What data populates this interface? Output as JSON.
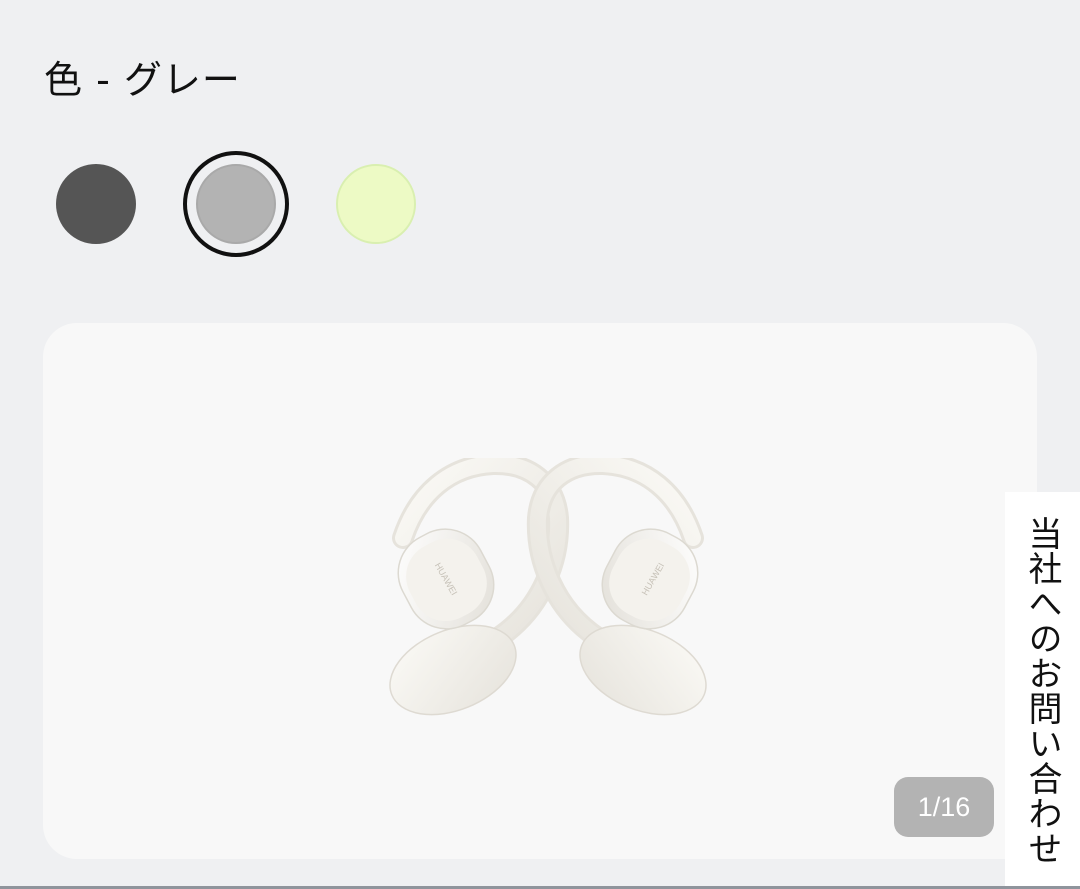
{
  "color_selector": {
    "label": "色 - グレー",
    "swatches": [
      {
        "name": "dark-gray",
        "color": "#555555",
        "selected": false
      },
      {
        "name": "gray",
        "color": "#b3b3b3",
        "selected": true
      },
      {
        "name": "lime",
        "color": "#edfac5",
        "selected": false
      }
    ]
  },
  "gallery": {
    "counter": "1/16",
    "product_brand_print": "HUAWEI"
  },
  "contact_tab": {
    "label": "当社へのお問い合わせ"
  }
}
